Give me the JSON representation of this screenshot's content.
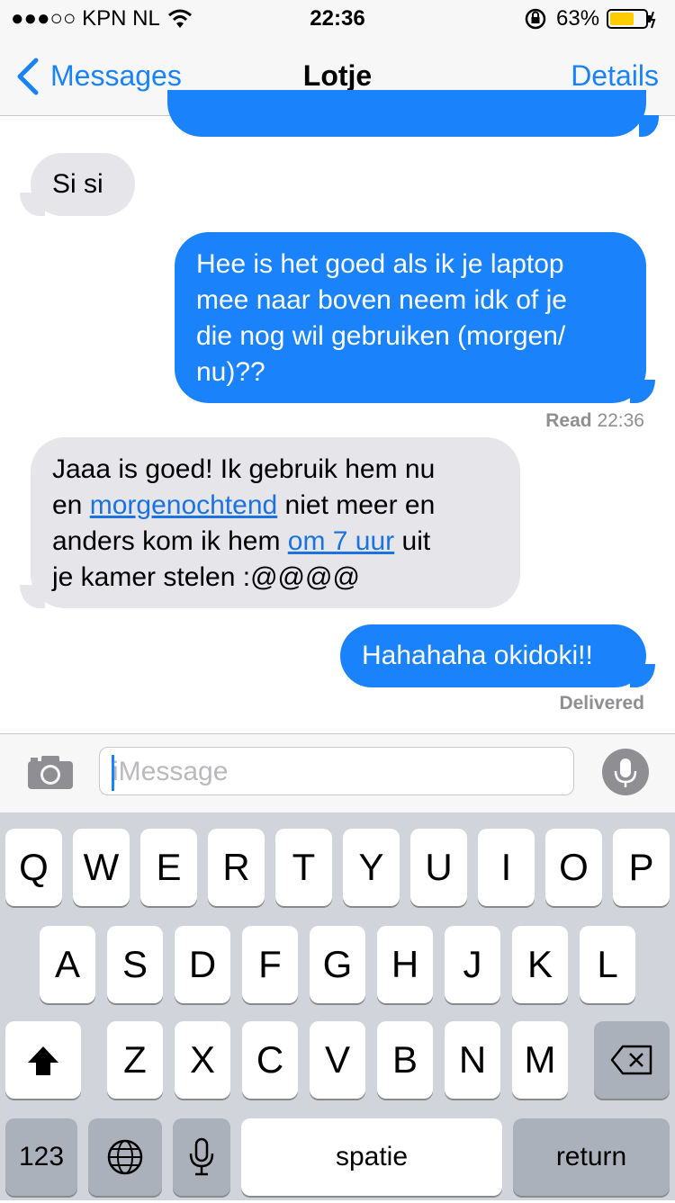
{
  "status_bar": {
    "carrier": "●●●○○ KPN NL",
    "time": "22:36",
    "battery": "63%"
  },
  "nav": {
    "back_label": "Messages",
    "title": "Lotje",
    "details_label": "Details"
  },
  "messages": [
    {
      "direction": "in",
      "text": "Si si"
    },
    {
      "direction": "out",
      "text": "Hee is het goed als ik je laptop\nmee naar boven neem idk of je\ndie nog wil gebruiken (morgen/\nnu)??"
    },
    {
      "direction": "in",
      "parts": {
        "p1": "Jaaa is goed! Ik gebruik hem nu\nen ",
        "link1": "morgenochtend",
        "p2": " niet meer en\nanders kom ik hem ",
        "link2": "om 7 uur",
        "p3": " uit\nje kamer stelen :@@@@"
      }
    },
    {
      "direction": "out",
      "text": "Hahahaha okidoki!!"
    }
  ],
  "read_receipt": {
    "label": "Read",
    "time": "22:36"
  },
  "delivered_label": "Delivered",
  "input": {
    "placeholder": "iMessage"
  },
  "keyboard": {
    "row1": [
      "Q",
      "W",
      "E",
      "R",
      "T",
      "Y",
      "U",
      "I",
      "O",
      "P"
    ],
    "row2": [
      "A",
      "S",
      "D",
      "F",
      "G",
      "H",
      "J",
      "K",
      "L"
    ],
    "row3": [
      "Z",
      "X",
      "C",
      "V",
      "B",
      "N",
      "M"
    ],
    "numbers_key": "123",
    "space_key": "spatie",
    "return_key": "return"
  },
  "colors": {
    "accent": "#1a82fb",
    "incoming_bubble": "#e5e5ea",
    "battery_fill": "#ffcc00"
  }
}
